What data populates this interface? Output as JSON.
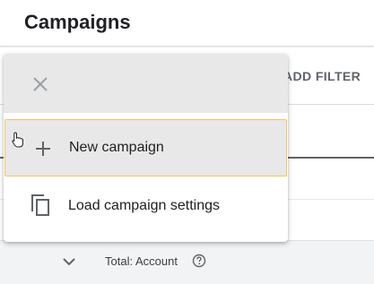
{
  "header": {
    "title": "Campaigns"
  },
  "filter_bar": {
    "add_filter_label": "ADD FILTER"
  },
  "menu": {
    "close_icon": "close-icon",
    "items": [
      {
        "label": "New campaign",
        "icon": "plus-icon"
      },
      {
        "label": "Load campaign settings",
        "icon": "copy-icon"
      }
    ]
  },
  "table": {
    "total_label": "Total: Account",
    "expand_icon": "chevron-down-icon",
    "help_icon": "help-icon"
  },
  "colors": {
    "accent_border": "#f5c45e",
    "menu_highlight": "#e8e8e8",
    "text_primary": "#202124",
    "text_secondary": "#5f6368"
  }
}
